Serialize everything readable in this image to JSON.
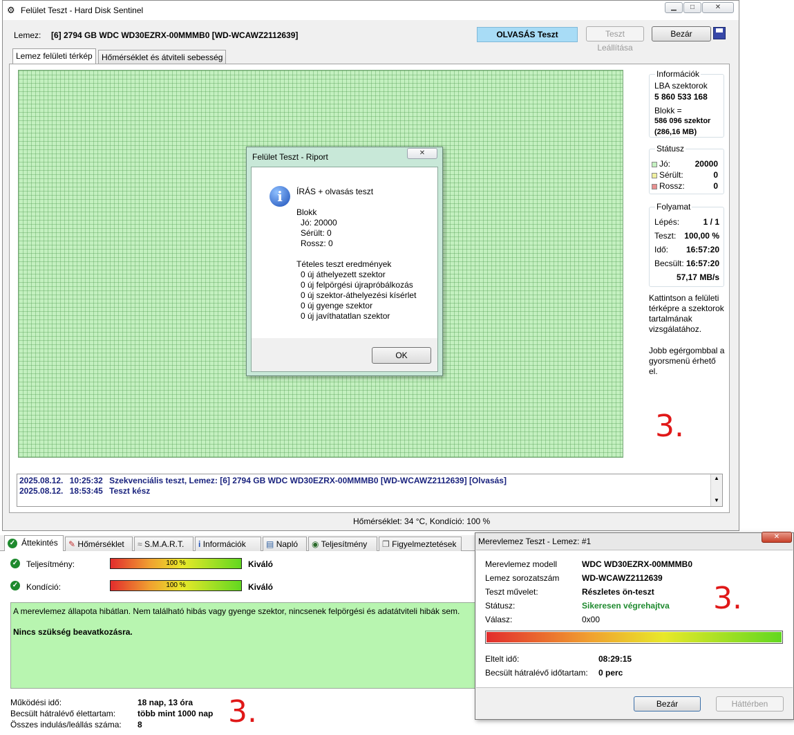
{
  "main_window": {
    "title": "Felület Teszt - Hard Disk Sentinel",
    "disk_label": "Lemez:",
    "disk_value": "[6] 2794 GB  WDC WD30EZRX-00MMMB0 [WD-WCAWZ2112639]",
    "mode_badge": "OLVASÁS Teszt",
    "stop_button": "Teszt Leállítása",
    "close_button": "Bezár",
    "tabs": [
      "Lemez felületi térkép",
      "Hőmérséklet és átviteli sebesség"
    ],
    "info": {
      "title": "Információk",
      "lba_label": "LBA szektorok",
      "lba_value": "5 860 533 168",
      "block_label": "Blokk =",
      "block_value": "586 096 szektor",
      "block_size": "(286,16 MB)"
    },
    "status": {
      "title": "Státusz",
      "good_label": "Jó:",
      "good_value": "20000",
      "damaged_label": "Sérült:",
      "damaged_value": "0",
      "bad_label": "Rossz:",
      "bad_value": "0"
    },
    "progress": {
      "title": "Folyamat",
      "step_label": "Lépés:",
      "step_value": "1 / 1",
      "test_label": "Teszt:",
      "test_value": "100,00 %",
      "time_label": "Idő:",
      "time_value": "16:57:20",
      "est_label": "Becsült:",
      "est_value": "16:57:20",
      "speed": "57,17 MB/s"
    },
    "hint1": "Kattintson a felületi térképre a szektorok tartalmának vizsgálatához.",
    "hint2": "Jobb egérgombbal a gyorsmenü érhető el.",
    "log": [
      {
        "date": "2025.08.12.",
        "time": "10:25:32",
        "text": "Szekvenciális teszt, Lemez: [6] 2794 GB  WDC WD30EZRX-00MMMB0 [WD-WCAWZ2112639] [Olvasás]"
      },
      {
        "date": "2025.08.12.",
        "time": "18:53:45",
        "text": "Teszt kész"
      }
    ],
    "statusbar": "Hőmérséklet: 34  °C,  Kondíció: 100 %"
  },
  "report_dialog": {
    "title": "Felület Teszt - Riport",
    "heading": "ÍRÁS + olvasás teszt",
    "block_title": "Blokk",
    "good": "Jó: 20000",
    "damaged": "Sérült: 0",
    "bad": "Rossz: 0",
    "results_title": "Tételes teszt eredmények",
    "results": [
      "0 új áthelyezett szektor",
      "0 új felpörgési újrapróbálkozás",
      "0 új szektor-áthelyezési kísérlet",
      "0 új gyenge szektor",
      "0 új javíthatatlan szektor"
    ],
    "ok_button": "OK"
  },
  "overview": {
    "tabs": [
      "Áttekintés",
      "Hőmérséklet",
      "S.M.A.R.T.",
      "Információk",
      "Napló",
      "Teljesítmény",
      "Figyelmeztetések"
    ],
    "performance_label": "Teljesítmény:",
    "performance_value": "100 %",
    "performance_level": 1.0,
    "performance_rating": "Kiváló",
    "condition_label": "Kondíció:",
    "condition_value": "100 %",
    "condition_level": 1.0,
    "condition_rating": "Kiváló",
    "message": "A merevlemez állapota hibátlan. Nem található hibás vagy gyenge szektor, nincsenek felpörgési és adatátviteli hibák sem.",
    "message_bold": "Nincs szükség beavatkozásra.",
    "uptime_label": "Működési idő:",
    "uptime_value": "18 nap, 13 óra",
    "lifetime_label": "Becsült hátralévő élettartam:",
    "lifetime_value": "több mint 1000 nap",
    "startstop_label": "Összes indulás/leállás száma:",
    "startstop_value": "8"
  },
  "selftest_dialog": {
    "title": "Merevlemez Teszt - Lemez: #1",
    "model_label": "Merevlemez modell",
    "model_value": "WDC WD30EZRX-00MMMB0",
    "serial_label": "Lemez sorozatszám",
    "serial_value": "WD-WCAWZ2112639",
    "op_label": "Teszt művelet:",
    "op_value": "Részletes ön-teszt",
    "status_label": "Státusz:",
    "status_value": "Sikeresen végrehajtva",
    "reply_label": "Válasz:",
    "reply_value": "0x00",
    "progress_level": 1.0,
    "elapsed_label": "Eltelt idő:",
    "elapsed_value": "08:29:15",
    "remaining_label": "Becsült hátralévő időtartam:",
    "remaining_value": "0 perc",
    "close_button": "Bezár",
    "background_button": "Háttérben"
  },
  "annotations": [
    "3.",
    "3.",
    "3."
  ],
  "colors": {
    "good": "#c4f0c0",
    "damaged": "#f0f0a0",
    "bad": "#e89090",
    "badge": "#a8dcf6",
    "log_text": "#1a237e",
    "success_text": "#1e8a2e",
    "message_bg": "#b8f5b0"
  }
}
